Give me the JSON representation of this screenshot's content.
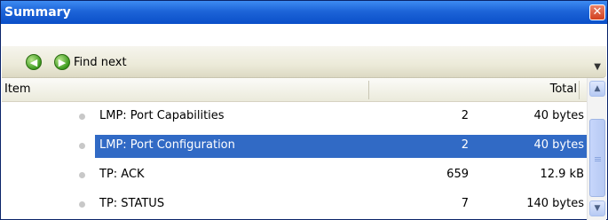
{
  "window": {
    "title": "Summary",
    "close_icon": "close-icon"
  },
  "toolbar": {
    "prev_icon": "arrow-left-circle-icon",
    "next_icon": "arrow-right-circle-icon",
    "find_next_label": "Find next"
  },
  "table": {
    "columns": [
      {
        "label": "Item"
      },
      {
        "label": "Total"
      }
    ],
    "rows": [
      {
        "label": "LMP: Port Capabilities",
        "count": "2",
        "size": "40 bytes",
        "selected": false
      },
      {
        "label": "LMP: Port Configuration",
        "count": "2",
        "size": "40 bytes",
        "selected": true
      },
      {
        "label": "TP: ACK",
        "count": "659",
        "size": "12.9 kB",
        "selected": false
      },
      {
        "label": "TP: STATUS",
        "count": "7",
        "size": "140 bytes",
        "selected": false
      }
    ]
  },
  "colors": {
    "title_bar": "#1d64d8",
    "selection": "#316ac5"
  }
}
